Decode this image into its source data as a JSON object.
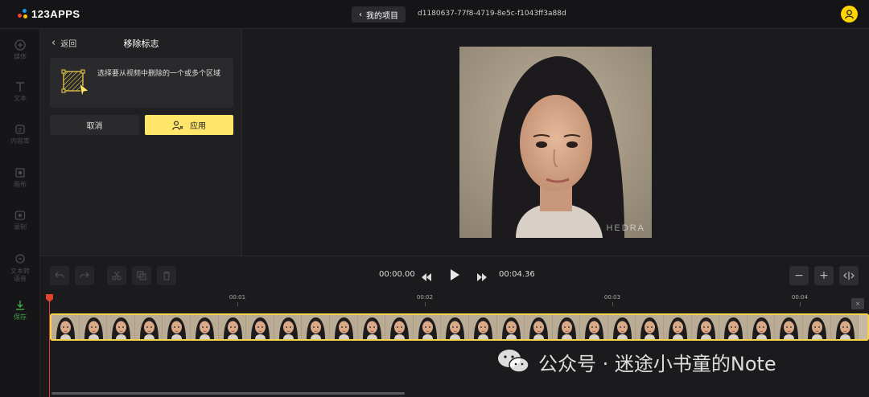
{
  "app": {
    "logo_text": "123APPS"
  },
  "header": {
    "back_label": "我的项目",
    "doc_id": "d1180637-77f8-4719-8e5c-f1043ff3a88d"
  },
  "nav": {
    "items": [
      {
        "label": "媒体",
        "icon": "plus-circle-icon"
      },
      {
        "label": "文本",
        "icon": "text-icon"
      },
      {
        "label": "内容库",
        "icon": "library-icon"
      },
      {
        "label": "画布",
        "icon": "canvas-icon"
      },
      {
        "label": "录制",
        "icon": "record-icon"
      },
      {
        "label": "文本转语音",
        "icon": "tts-icon"
      },
      {
        "label": "保存",
        "icon": "download-icon"
      }
    ]
  },
  "panel": {
    "back_label": "返回",
    "title": "移除标志",
    "info_text": "选择要从视频中删除的一个或多个区域",
    "cancel_label": "取消",
    "apply_label": "应用"
  },
  "preview": {
    "watermark": "HEDRA"
  },
  "player": {
    "current_time": "00:00.00",
    "total_time": "00:04.36"
  },
  "timeline": {
    "ticks": [
      "00:01",
      "00:02",
      "00:03",
      "00:04"
    ],
    "end_marker": "×"
  },
  "overlay": {
    "wechat_text": "公众号 · 迷途小书童的Note"
  },
  "colors": {
    "accent": "#ffe66b",
    "playhead": "#e0452b",
    "save": "#3fa34d"
  }
}
